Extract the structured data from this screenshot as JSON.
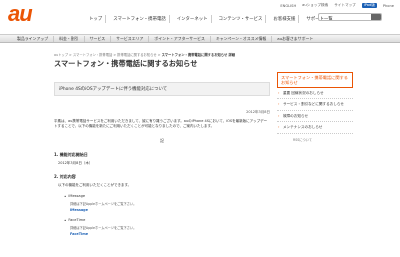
{
  "header": {
    "logo": "au",
    "util_links": [
      "ENGLISH",
      "auショップ検索",
      "サイトマップ"
    ],
    "util_badge": "iPad版",
    "util_right": "Phone"
  },
  "gnav": [
    "トップ",
    "スマートフォン・携帯電話",
    "インターネット",
    "コンテンツ・サービス",
    "お客様支援",
    "サポート一覧"
  ],
  "subnav": [
    "製品ラインアップ",
    "料金・割引",
    "サービス",
    "サービスエリア",
    "ポイント・アフターサービス",
    "キャンペーン・オススメ情報",
    "auお客さまサポート"
  ],
  "breadcrumb": {
    "trail": "auトップ > スマートフォン・携帯電話 > 携帯電話に関するお知らせ >",
    "current": "スマートフォン・携帯電話に関するお知らせ 詳細"
  },
  "page": {
    "title": "スマートフォン・携帯電話に関するお知らせ",
    "headline": "iPhone 4SのiOSアップデートに伴う機能対応について",
    "date": "2012年3月8日",
    "intro": "平素は、au携帯電話サービスをご利用いただきまして、誠に有り難うございます。auのiPhone 4Sにおいて、iOSを最新版にアップデートすることで、以下の機能を新たにご利用いただくことが可能となりましたので、ご案内いたします。",
    "ki": "記",
    "sections": [
      {
        "heading": "1. 機能対応開始日",
        "value": "2012年3月8日（木）"
      },
      {
        "heading": "2. 対応内容",
        "value": ""
      }
    ],
    "section2_note": "以下の機能をご利用いただくことができます。",
    "services": [
      {
        "name": "iMessage",
        "link": "詳細は下記Appleホームページをご覧下さい。",
        "logo": "iMessage"
      },
      {
        "name": "FaceTime",
        "link": "詳細は下記Appleホームページをご覧下さい。",
        "logo": "FaceTime"
      }
    ]
  },
  "sidebar": {
    "head": "スマートフォン・携帯電話に関するお知らせ",
    "items": [
      "重要 回線状況のおしらせ",
      "サービス・割引などに関するおしらせ",
      "故障のお知らせ",
      "メンテナンスのおしらせ"
    ],
    "footer": "RSSについて"
  }
}
